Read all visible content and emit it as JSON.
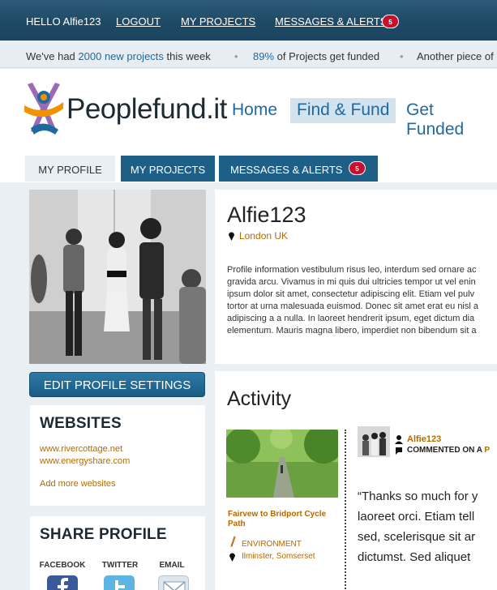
{
  "topbar": {
    "greeting": "HELLO Alfie123",
    "logout": "LOGOUT",
    "my_projects": "MY PROJECTS",
    "messages": "MESSAGES & ALERTS",
    "messages_count": "5"
  },
  "ticker": {
    "part1": "We've had",
    "highlight1": "2000 new projects",
    "part2": "this week",
    "highlight2": "89%",
    "part3": "of Projects get funded",
    "part4": "Another piece of"
  },
  "brand": {
    "name": "Peoplefund.it",
    "colors": {
      "orange": "#f39200",
      "blue": "#1e6aa0",
      "purple": "#8a4fa8",
      "dark": "#1b2a33"
    }
  },
  "nav": {
    "items": [
      {
        "label": "Home",
        "active": false
      },
      {
        "label": "Find & Fund",
        "active": true
      },
      {
        "label": "Get Funded",
        "active": false
      }
    ]
  },
  "tabs": [
    {
      "label": "MY PROFILE",
      "active": true
    },
    {
      "label": "MY PROJECTS",
      "active": false
    },
    {
      "label": "MESSAGES & ALERTS",
      "active": false,
      "badge": "5"
    }
  ],
  "sidebar": {
    "edit_button": "EDIT PROFILE SETTINGS",
    "websites_title": "WEBSITES",
    "websites": [
      "www.rivercottage.net",
      "www.energyshare.com"
    ],
    "add_websites": "Add more websites",
    "share_title": "SHARE PROFILE",
    "share": [
      {
        "label": "FACEBOOK",
        "icon": "facebook-icon"
      },
      {
        "label": "TWITTER",
        "icon": "twitter-icon"
      },
      {
        "label": "EMAIL",
        "icon": "email-icon"
      }
    ]
  },
  "profile": {
    "username": "Alfie123",
    "location": "London UK",
    "bio_lines": [
      "Profile information vestibulum risus leo, interdum sed ornare ac",
      "gravida arcu. Vivamus in mi quis dui ultricies tempor ut vel enin",
      "ipsum dolor sit amet, consectetur adipiscing elit. Etiam vel pulv",
      "tortor at urna malesuada euismod. Donec sit amet erat eu nisl a",
      "adipiscing a a nulla. In laoreet hendrerit ipsum, eget dictum dia",
      "elementum. Mauris magna libero, imperdiet non bibendum sit a"
    ]
  },
  "activity": {
    "title": "Activity",
    "project_title": "Fairvew to Bridport Cycle Path",
    "category": "ENVIRONMENT",
    "project_location": "Ilminster, Somserset",
    "user": "Alfie123",
    "action": "COMMENTED ON A",
    "action_trail": "P",
    "quote_lines": [
      "“Thanks so much for y",
      "laoreet orci. Etiam tell",
      "sed, scelerisque sit ar",
      "dictumst. Sed aliquet"
    ]
  }
}
